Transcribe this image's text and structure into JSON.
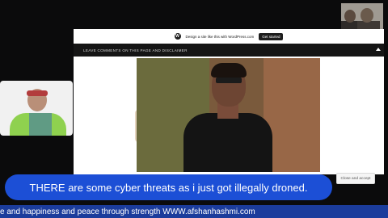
{
  "wp_bar": {
    "message": "Design a site like this with WordPress.com",
    "button": "Get started",
    "logo_letter": "W"
  },
  "site_nav": {
    "menu_item": "LEAVE COMMENTS ON THIS PAGE AND DISCLAIMER"
  },
  "cookie": {
    "close_button": "Close and accept"
  },
  "caption": {
    "text": "THERE are some cyber threats as i just got illegally droned."
  },
  "ticker": {
    "text": "e and happiness and peace through strength WWW.afshanhashmi.com"
  },
  "colors": {
    "caption_bg": "#1c4fd6",
    "ticker_bg": "#1b3c9c",
    "nav_bg": "#151515"
  }
}
